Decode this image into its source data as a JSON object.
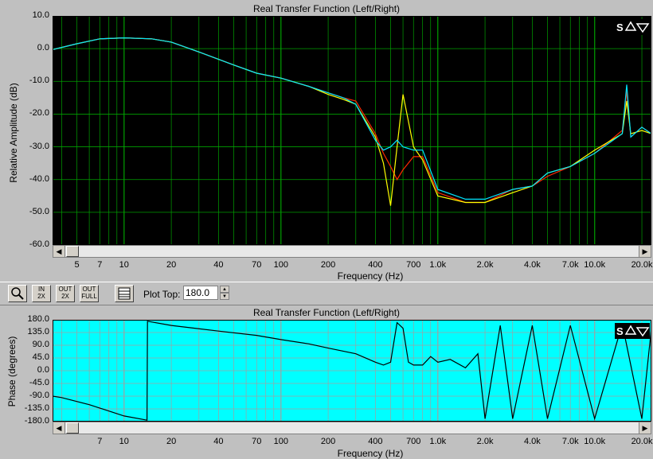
{
  "magnitude": {
    "title": "Real Transfer Function (Left/Right)",
    "ylabel": "Relative Amplitude (dB)",
    "xlabel": "Frequency (Hz)",
    "yticks": [
      "10.0",
      "0.0",
      "-10.0",
      "-20.0",
      "-30.0",
      "-40.0",
      "-50.0",
      "-60.0"
    ],
    "xticks": [
      "5",
      "7",
      "10",
      "20",
      "40",
      "70",
      "100",
      "200",
      "400",
      "700",
      "1.0k",
      "2.0k",
      "4.0k",
      "7.0k",
      "10.0k",
      "20.0k"
    ],
    "colors": {
      "background": "#000000",
      "grid": "#00a000",
      "series": [
        "#ff2a00",
        "#ffff00",
        "#00e5ff"
      ]
    }
  },
  "phase": {
    "title": "Real Transfer Function (Left/Right)",
    "ylabel": "Phase (degrees)",
    "xlabel": "Frequency (Hz)",
    "yticks": [
      "180.0",
      "135.0",
      "90.0",
      "45.0",
      "0.0",
      "-45.0",
      "-90.0",
      "-135.0",
      "-180.0"
    ],
    "xticks": [
      "7",
      "10",
      "20",
      "40",
      "70",
      "100",
      "200",
      "400",
      "700",
      "1.0k",
      "2.0k",
      "4.0k",
      "7.0k",
      "10.0k",
      "20.0k"
    ],
    "colors": {
      "background": "#00ffff",
      "grid": "#a0a0a0",
      "series": [
        "#000000"
      ]
    }
  },
  "toolbar": {
    "plot_top_label": "Plot Top:",
    "plot_top_value": "180.0",
    "buttons": [
      "zoom",
      "in 2X",
      "out 2X",
      "out full",
      "table"
    ]
  },
  "chart_data": [
    {
      "type": "line",
      "title": "Real Transfer Function (Left/Right)",
      "xlabel": "Frequency (Hz)",
      "ylabel": "Relative Amplitude (dB)",
      "xscale": "log",
      "xlim": [
        3.5,
        23000
      ],
      "ylim": [
        -60,
        10
      ],
      "grid": true,
      "x": [
        3.5,
        5,
        7,
        10,
        15,
        20,
        30,
        50,
        70,
        100,
        150,
        200,
        250,
        300,
        400,
        450,
        500,
        550,
        600,
        700,
        800,
        1000,
        1500,
        2000,
        3000,
        4000,
        5000,
        7000,
        10000,
        15000,
        16000,
        17000,
        20000,
        23000
      ],
      "series": [
        {
          "values": [
            -0.3,
            1.5,
            3.0,
            3.3,
            3.0,
            2.0,
            -1.0,
            -5.0,
            -7.5,
            -9.0,
            -11.5,
            -13.5,
            -15.0,
            -16.0,
            -26.0,
            -32.0,
            -36.0,
            -40.0,
            -37.0,
            -33.0,
            -33.0,
            -44.0,
            -47.0,
            -47.0,
            -43.0,
            -42.0,
            -39.0,
            -36.0,
            -32.0,
            -25.0,
            -13.0,
            -27.0,
            -24.0,
            -26.0
          ]
        },
        {
          "values": [
            -0.3,
            1.5,
            3.0,
            3.3,
            3.0,
            2.0,
            -1.0,
            -5.0,
            -7.5,
            -9.0,
            -11.5,
            -14.0,
            -15.5,
            -17.0,
            -27.0,
            -35.0,
            -48.0,
            -30.0,
            -14.0,
            -30.0,
            -34.0,
            -45.0,
            -47.0,
            -47.0,
            -44.0,
            -42.0,
            -38.0,
            -36.0,
            -31.0,
            -26.0,
            -16.0,
            -26.0,
            -25.0,
            -26.0
          ]
        },
        {
          "values": [
            -0.3,
            1.5,
            3.0,
            3.3,
            3.0,
            2.0,
            -1.0,
            -5.0,
            -7.5,
            -9.0,
            -11.5,
            -13.5,
            -15.0,
            -17.0,
            -28.0,
            -31.0,
            -30.0,
            -28.0,
            -30.0,
            -31.0,
            -31.0,
            -43.0,
            -46.0,
            -46.0,
            -43.0,
            -42.0,
            -38.0,
            -36.0,
            -32.0,
            -26.0,
            -11.0,
            -27.0,
            -24.0,
            -26.0
          ]
        }
      ]
    },
    {
      "type": "line",
      "title": "Real Transfer Function (Left/Right)",
      "xlabel": "Frequency (Hz)",
      "ylabel": "Phase (degrees)",
      "xscale": "log",
      "xlim": [
        3.5,
        23000
      ],
      "ylim": [
        -180,
        180
      ],
      "grid": true,
      "x": [
        3.5,
        4,
        6,
        10,
        14,
        14.1,
        20,
        40,
        70,
        100,
        150,
        200,
        300,
        400,
        450,
        500,
        550,
        600,
        650,
        700,
        800,
        900,
        1000,
        1200,
        1500,
        1800,
        2000,
        2500,
        3000,
        4000,
        5000,
        7000,
        10000,
        15000,
        20000,
        23000
      ],
      "series": [
        {
          "values": [
            -90,
            -95,
            -120,
            -160,
            -175,
            175,
            160,
            140,
            125,
            110,
            95,
            80,
            60,
            30,
            20,
            30,
            170,
            150,
            30,
            20,
            20,
            50,
            30,
            40,
            10,
            60,
            -170,
            160,
            -170,
            160,
            -170,
            160,
            -170,
            165,
            -170,
            150
          ]
        }
      ]
    }
  ]
}
